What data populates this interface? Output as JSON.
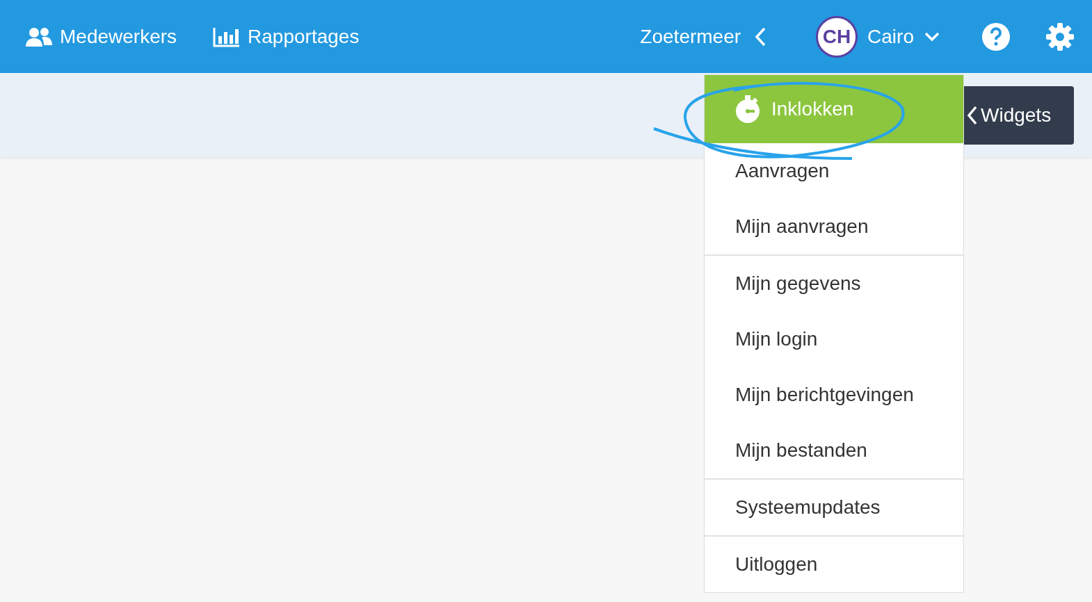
{
  "nav": [
    {
      "label": "Medewerkers",
      "kind": "people"
    },
    {
      "label": "Rapportages",
      "kind": "chart"
    }
  ],
  "location": {
    "label": "Zoetermeer"
  },
  "user": {
    "initials": "CH",
    "name": "Cairo"
  },
  "widgets": {
    "label": "Widgets"
  },
  "menu": [
    {
      "label": "Inklokken",
      "kind": "action",
      "divider_after": false
    },
    {
      "label": "Aanvragen",
      "kind": "link",
      "divider_after": false
    },
    {
      "label": "Mijn aanvragen",
      "kind": "link",
      "divider_after": true
    },
    {
      "label": "Mijn gegevens",
      "kind": "link",
      "divider_after": false
    },
    {
      "label": "Mijn login",
      "kind": "link",
      "divider_after": false
    },
    {
      "label": "Mijn berichtgevingen",
      "kind": "link",
      "divider_after": false
    },
    {
      "label": "Mijn bestanden",
      "kind": "link",
      "divider_after": true
    },
    {
      "label": "Systeemupdates",
      "kind": "link",
      "divider_after": true
    },
    {
      "label": "Uitloggen",
      "kind": "link",
      "divider_after": false
    }
  ]
}
